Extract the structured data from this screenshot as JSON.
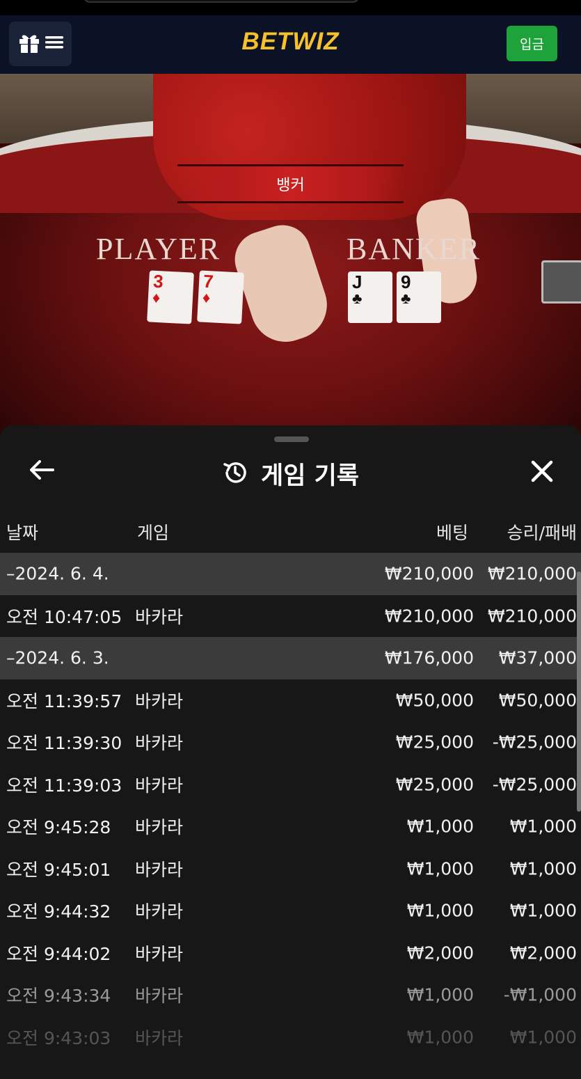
{
  "header": {
    "logo_bet": "BET",
    "logo_wiz": "WIZ",
    "deposit_label": "입금"
  },
  "scene": {
    "banner_label": "뱅커",
    "player_label": "PLAYER",
    "banker_label": "BANKER",
    "player_cards": [
      {
        "rank": "3",
        "suit": "♦",
        "color": "#d01818"
      },
      {
        "rank": "7",
        "suit": "♦",
        "color": "#d01818"
      }
    ],
    "banker_cards": [
      {
        "rank": "J",
        "suit": "♣",
        "color": "#111111"
      },
      {
        "rank": "9",
        "suit": "♣",
        "color": "#111111"
      }
    ]
  },
  "sheet": {
    "title": "게임 기록",
    "back_icon": "arrow-left-icon",
    "history_icon": "history-icon",
    "close_icon": "close-icon",
    "columns": {
      "date": "날짜",
      "game": "게임",
      "bet": "베팅",
      "result": "승리/패배"
    },
    "rows": [
      {
        "type": "group",
        "date": "–2024. 6. 4.",
        "game": "",
        "bet": "₩210,000",
        "result": "₩210,000"
      },
      {
        "type": "item",
        "date": "오전 10:47:05",
        "game": "바카라",
        "bet": "₩210,000",
        "result": "₩210,000"
      },
      {
        "type": "group",
        "date": "–2024. 6. 3.",
        "game": "",
        "bet": "₩176,000",
        "result": "₩37,000"
      },
      {
        "type": "item",
        "date": "오전 11:39:57",
        "game": "바카라",
        "bet": "₩50,000",
        "result": "₩50,000"
      },
      {
        "type": "item",
        "date": "오전 11:39:30",
        "game": "바카라",
        "bet": "₩25,000",
        "result": "-₩25,000"
      },
      {
        "type": "item",
        "date": "오전 11:39:03",
        "game": "바카라",
        "bet": "₩25,000",
        "result": "-₩25,000"
      },
      {
        "type": "item",
        "date": "오전 9:45:28",
        "game": "바카라",
        "bet": "₩1,000",
        "result": "₩1,000"
      },
      {
        "type": "item",
        "date": "오전 9:45:01",
        "game": "바카라",
        "bet": "₩1,000",
        "result": "₩1,000"
      },
      {
        "type": "item",
        "date": "오전 9:44:32",
        "game": "바카라",
        "bet": "₩1,000",
        "result": "₩1,000"
      },
      {
        "type": "item",
        "date": "오전 9:44:02",
        "game": "바카라",
        "bet": "₩2,000",
        "result": "₩2,000"
      },
      {
        "type": "item",
        "date": "오전 9:43:34",
        "game": "바카라",
        "bet": "₩1,000",
        "result": "-₩1,000"
      },
      {
        "type": "item",
        "date": "오전 9:43:03",
        "game": "바카라",
        "bet": "₩1,000",
        "result": "₩1,000"
      }
    ]
  },
  "colors": {
    "header_bg": "#0b1226",
    "logo": "#f5c12c",
    "deposit": "#1ea23a",
    "group_row": "#3b3b3b",
    "sheet_bg": "#181818"
  }
}
